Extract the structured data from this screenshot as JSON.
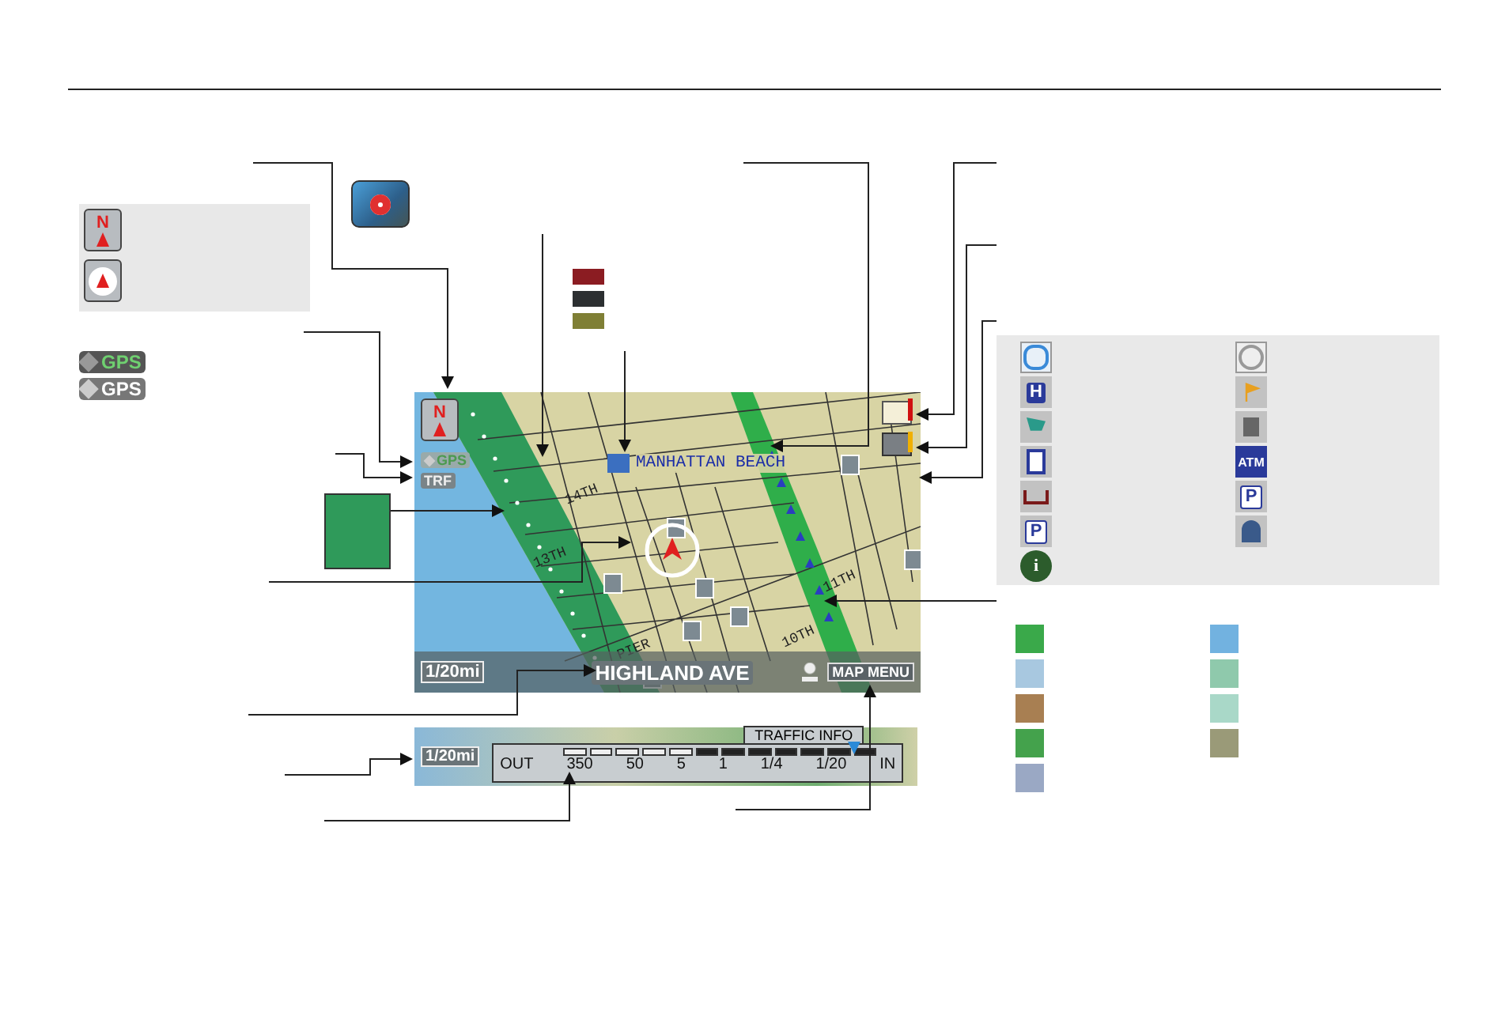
{
  "north_legend": [
    {
      "kind": "north_up",
      "glyph": "N"
    },
    {
      "kind": "heading_up"
    }
  ],
  "gps_legend": [
    {
      "label": "GPS",
      "on": true
    },
    {
      "label": "GPS",
      "on": false
    }
  ],
  "traffic_colors": [
    {
      "color": "#8b1c22"
    },
    {
      "color": "#2c2f31"
    },
    {
      "color": "#7f7f35"
    }
  ],
  "map": {
    "north_glyph": "N",
    "gps": "GPS",
    "traffic": "TRF",
    "place": "MANHATTAN BEACH",
    "streets": [
      "14TH",
      "13TH",
      "11TH",
      "10TH",
      "PIER"
    ],
    "scale": "1/20mi",
    "street": "HIGHLAND AVE",
    "menu": "MAP MENU"
  },
  "traffic_strip": {
    "scale": "1/20mi",
    "title": "TRAFFIC INFO",
    "ticks": [
      "OUT",
      "350",
      "50",
      "5",
      "1",
      "1/4",
      "1/20",
      "IN"
    ],
    "segments": [
      {
        "on": false
      },
      {
        "on": false
      },
      {
        "on": false
      },
      {
        "on": false
      },
      {
        "on": false
      },
      {
        "on": true
      },
      {
        "on": true
      },
      {
        "on": true
      },
      {
        "on": true
      },
      {
        "on": true
      },
      {
        "on": true
      },
      {
        "on": true
      }
    ],
    "level": 0.93
  },
  "poi_legend": [
    {
      "kind": "emblem"
    },
    {
      "kind": "emblem_alt"
    },
    {
      "kind": "hospital",
      "glyph": "H"
    },
    {
      "kind": "flag"
    },
    {
      "kind": "cart"
    },
    {
      "kind": "restaurant"
    },
    {
      "kind": "fuel"
    },
    {
      "kind": "atm",
      "glyph": "ATM"
    },
    {
      "kind": "bed"
    },
    {
      "kind": "parking",
      "glyph": "P"
    },
    {
      "kind": "parking_house",
      "glyph": "P"
    },
    {
      "kind": "mailbox"
    },
    {
      "kind": "info",
      "glyph": "i"
    }
  ],
  "area_colors": [
    {
      "color": "#3aa94a"
    },
    {
      "color": "#72b2e0"
    },
    {
      "color": "#a8c8e0"
    },
    {
      "color": "#8fc9ac"
    },
    {
      "color": "#a87f52"
    },
    {
      "color": "#a9d8c8"
    },
    {
      "color": "#44a24c"
    },
    {
      "color": "#9a9a78"
    },
    {
      "color": "#9aa8c4"
    }
  ]
}
